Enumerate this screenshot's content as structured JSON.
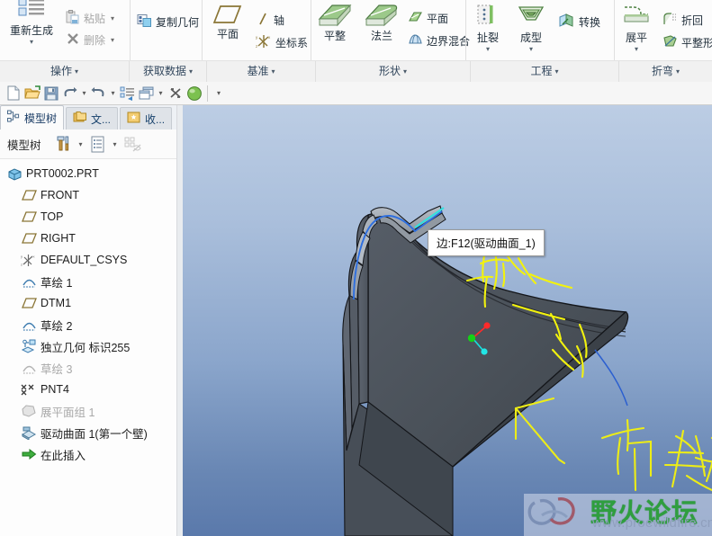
{
  "ribbon": {
    "groups": [
      {
        "label": "操作",
        "caret": "▾",
        "items": [
          {
            "name": "regenerate",
            "label": "重新生成",
            "type": "big",
            "caret": "▾",
            "icon": "regenerate-icon"
          },
          {
            "name": "paste",
            "label": "粘贴",
            "type": "small",
            "caret": "▾",
            "disabled": true,
            "icon": "paste-icon"
          },
          {
            "name": "delete",
            "label": "删除",
            "type": "small",
            "caret": "▾",
            "disabled": true,
            "icon": "delete-icon"
          }
        ]
      },
      {
        "label": "获取数据",
        "caret": "▾",
        "items": [
          {
            "name": "copy-geometry",
            "label": "复制几何",
            "type": "small",
            "caret": "",
            "disabled": false,
            "icon": "copy-geometry-icon"
          }
        ]
      },
      {
        "label": "基准",
        "caret": "▾",
        "items": [
          {
            "name": "datum-plane",
            "label": "平面",
            "type": "big",
            "caret": "",
            "icon": "plane-icon"
          },
          {
            "name": "datum-axis",
            "label": "轴",
            "type": "small",
            "caret": "",
            "disabled": false,
            "icon": "axis-icon"
          },
          {
            "name": "datum-csys",
            "label": "坐标系",
            "type": "small",
            "caret": "",
            "disabled": false,
            "icon": "csys-icon"
          }
        ]
      },
      {
        "label": "形状",
        "caret": "▾",
        "items": [
          {
            "name": "flat-wall",
            "label": "平整",
            "type": "big",
            "caret": "",
            "icon": "flat-wall-icon"
          },
          {
            "name": "flange-wall",
            "label": "法兰",
            "type": "big",
            "caret": "",
            "icon": "flange-wall-icon"
          },
          {
            "name": "surface-plane",
            "label": "平面",
            "type": "small",
            "caret": "",
            "disabled": false,
            "icon": "surface-plane-icon"
          },
          {
            "name": "boundary-blend",
            "label": "边界混合",
            "type": "small",
            "caret": "",
            "disabled": false,
            "icon": "boundary-blend-icon"
          }
        ]
      },
      {
        "label": "工程",
        "caret": "▾",
        "items": [
          {
            "name": "rip",
            "label": "扯裂",
            "type": "big",
            "caret": "▾",
            "icon": "rip-icon"
          },
          {
            "name": "form",
            "label": "成型",
            "type": "big",
            "caret": "▾",
            "icon": "form-icon"
          },
          {
            "name": "convert",
            "label": "转换",
            "type": "small",
            "caret": "",
            "disabled": false,
            "icon": "convert-icon"
          }
        ]
      },
      {
        "label": "折弯",
        "caret": "▾",
        "items": [
          {
            "name": "unbend",
            "label": "展平",
            "type": "big",
            "caret": "▾",
            "icon": "unbend-icon"
          },
          {
            "name": "bend-back",
            "label": "折回",
            "type": "small",
            "caret": "",
            "disabled": false,
            "icon": "bend-back-icon"
          },
          {
            "name": "flat-state",
            "label": "平整形态",
            "type": "small",
            "caret": "",
            "disabled": false,
            "icon": "flat-state-icon"
          }
        ]
      }
    ]
  },
  "quick_toolbar": {
    "buttons": [
      {
        "name": "new-file-button",
        "icon": "new-document-icon",
        "title": "新建"
      },
      {
        "name": "open-file-button",
        "icon": "open-folder-icon",
        "title": "打开"
      },
      {
        "name": "save-file-button",
        "icon": "save-disk-icon",
        "title": "保存"
      },
      {
        "name": "undo-button",
        "icon": "undo-arrow-icon",
        "title": "撤消",
        "caret": "▾"
      },
      {
        "name": "redo-button",
        "icon": "redo-arrow-icon",
        "title": "重做",
        "caret": "▾"
      },
      {
        "name": "regenerate-button",
        "icon": "regenerate-list-icon",
        "title": "重新生成"
      },
      {
        "name": "window-button",
        "icon": "windows-cascade-icon",
        "title": "窗口",
        "caret": "▾"
      },
      {
        "name": "close-window-button",
        "icon": "close-x-icon",
        "title": "关闭"
      },
      {
        "name": "appearance-button",
        "icon": "sphere-appearance-icon",
        "title": "外观"
      }
    ],
    "overflow_caret": "▾"
  },
  "left_panel": {
    "tabs": [
      {
        "name": "tab-model-tree",
        "label": "模型树",
        "icon": "model-tree-icon",
        "active": true
      },
      {
        "name": "tab-folder-browser",
        "label": "文...",
        "icon": "folder-browser-icon",
        "active": false
      },
      {
        "name": "tab-favorites",
        "label": "收...",
        "icon": "favorites-star-icon",
        "active": false
      }
    ],
    "tree_toolbar": {
      "title": "模型树",
      "buttons": [
        {
          "name": "tree-settings-button",
          "icon": "tools-hammer-icon",
          "caret": "▾"
        },
        {
          "name": "tree-display-button",
          "icon": "list-display-icon",
          "caret": "▾"
        },
        {
          "name": "tree-filter-button",
          "icon": "filter-hidden-icon",
          "caret": ""
        }
      ]
    },
    "tree": [
      {
        "name": "tree-item-part",
        "label": "PRT0002.PRT",
        "icon": "part-cube-icon",
        "indent": 0,
        "dim": false
      },
      {
        "name": "tree-item-front",
        "label": "FRONT",
        "icon": "datum-plane-icon",
        "indent": 1,
        "dim": false
      },
      {
        "name": "tree-item-top",
        "label": "TOP",
        "icon": "datum-plane-icon",
        "indent": 1,
        "dim": false
      },
      {
        "name": "tree-item-right",
        "label": "RIGHT",
        "icon": "datum-plane-icon",
        "indent": 1,
        "dim": false
      },
      {
        "name": "tree-item-default-csys",
        "label": "DEFAULT_CSYS",
        "icon": "datum-csys-icon",
        "indent": 1,
        "dim": false
      },
      {
        "name": "tree-item-sketch-1",
        "label": "草绘 1",
        "icon": "sketch-icon",
        "indent": 1,
        "dim": false
      },
      {
        "name": "tree-item-dtm1",
        "label": "DTM1",
        "icon": "datum-plane-icon",
        "indent": 1,
        "dim": false
      },
      {
        "name": "tree-item-sketch-2",
        "label": "草绘 2",
        "icon": "sketch-icon",
        "indent": 1,
        "dim": false
      },
      {
        "name": "tree-item-independent-geom",
        "label": "独立几何 标识255",
        "icon": "independent-geom-icon",
        "indent": 1,
        "dim": false
      },
      {
        "name": "tree-item-sketch-3",
        "label": "草绘 3",
        "icon": "sketch-icon",
        "indent": 1,
        "dim": true
      },
      {
        "name": "tree-item-pnt4",
        "label": "PNT4",
        "icon": "datum-point-icon",
        "indent": 1,
        "dim": false
      },
      {
        "name": "tree-item-flat-quilt-1",
        "label": "展平面组 1",
        "icon": "flat-quilt-icon",
        "indent": 1,
        "dim": true
      },
      {
        "name": "tree-item-driving-surface-1",
        "label": "驱动曲面 1(第一个壁)",
        "icon": "driving-surface-icon",
        "indent": 1,
        "dim": false
      },
      {
        "name": "tree-item-insert-here",
        "label": "在此插入",
        "icon": "insert-arrow-icon",
        "indent": 1,
        "dim": false
      }
    ]
  },
  "viewport": {
    "tooltip": "边:F12(驱动曲面_1)",
    "annotations": [
      {
        "name": "annotation-arc-handwriting",
        "text": "孤",
        "color": "#f5f50a"
      },
      {
        "name": "annotation-line-handwriting",
        "text": "方线",
        "color": "#e6e620"
      }
    ],
    "csys": {
      "name": "coordinate-system-marker",
      "axis_colors": {
        "x": "#ff2a2a",
        "y": "#16d016",
        "z": "#16e0e0"
      }
    },
    "model": {
      "name": "sheetmetal-part-model",
      "face_color": "#4c525c",
      "highlight_edge_color": "#2e6fe0",
      "selected_edge_color": "#33e0e0"
    },
    "background_top": "#bccde4",
    "background_bottom": "#5a79ab"
  },
  "watermark": {
    "title": "野火论坛",
    "url": "www.proewildfire.cn",
    "title_color": "#2f9e3f",
    "url_color": "#8f9fbd"
  }
}
